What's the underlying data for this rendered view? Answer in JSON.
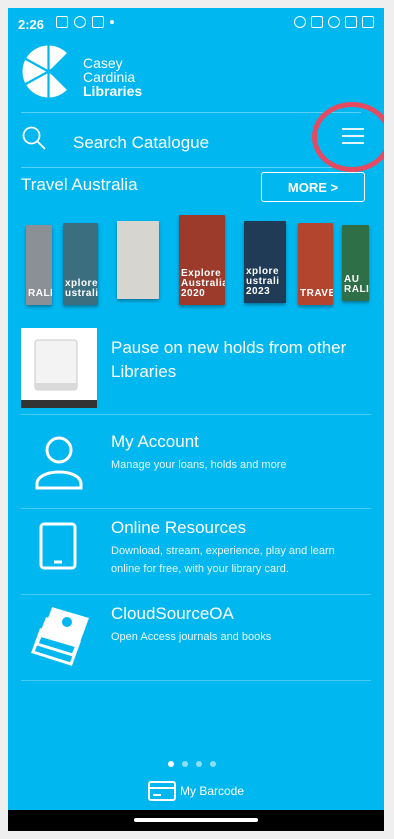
{
  "status": {
    "time": "2:26"
  },
  "logo": {
    "line1": "Casey",
    "line2": "Cardinia",
    "line3": "Libraries"
  },
  "search": {
    "placeholder": "Search Catalogue"
  },
  "featured": {
    "title": "Travel Australia",
    "more_label": "MORE >",
    "books": [
      {
        "title": "RALIA",
        "color": "#8b8f96"
      },
      {
        "title": "xplore ustralia",
        "color": "#3b6f80"
      },
      {
        "title": "",
        "color": "#d7d5d0"
      },
      {
        "title": "Explore Australia 2020",
        "color": "#9c3b2c"
      },
      {
        "title": "xplore ustrali 2023",
        "color": "#1f3b55"
      },
      {
        "title": "TRAVEL",
        "color": "#b3452f"
      },
      {
        "title": "AU RALI",
        "color": "#2f6f48"
      }
    ]
  },
  "features": [
    {
      "title": "Pause on new holds from other Libraries",
      "desc": ""
    },
    {
      "title": "My Account",
      "desc": "Manage your loans, holds and more"
    },
    {
      "title": "Online Resources",
      "desc": "Download, stream, experience, play and learn online for free, with your library card."
    },
    {
      "title": "CloudSourceOA",
      "desc": "Open Access journals and books"
    }
  ],
  "pager": {
    "count": 4,
    "active": 1
  },
  "barcode": {
    "label": "My Barcode"
  },
  "colors": {
    "background": "#01b7f0",
    "highlight_ring": "#e64a61"
  }
}
